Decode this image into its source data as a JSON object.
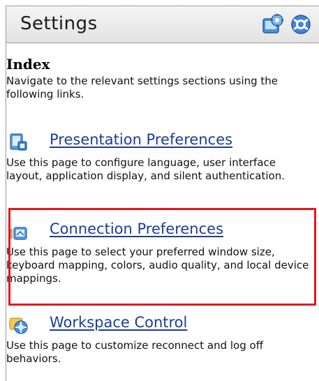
{
  "header": {
    "title": "Settings",
    "icons": [
      "settings-icon",
      "help-icon"
    ]
  },
  "index": {
    "title": "Index",
    "description": "Navigate to the relevant settings sections using the following links."
  },
  "sections": [
    {
      "label": "Presentation Preferences",
      "description": "Use this page to configure language, user interface layout, application display, and silent authentication.",
      "icon": "monitor-icon"
    },
    {
      "label": "Connection Preferences",
      "description": "Use this page to select your preferred window size, keyboard mapping, colors, audio quality, and local device mappings.",
      "icon": "connection-icon"
    },
    {
      "label": "Workspace Control",
      "description": "Use this page to customize reconnect and log off behaviors.",
      "icon": "workspace-icon"
    }
  ],
  "colors": {
    "link": "#1c3c98",
    "highlight": "#e8141e"
  }
}
